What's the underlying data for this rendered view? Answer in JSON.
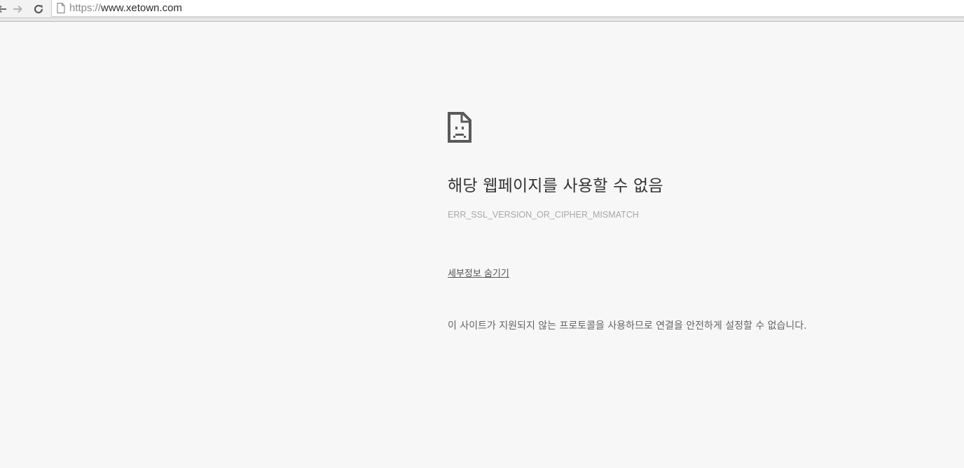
{
  "browser": {
    "url_scheme": "https://",
    "url_host": "www.xetown.com"
  },
  "error_page": {
    "icon": "sad-page-icon",
    "heading": "해당 웹페이지를 사용할 수 없음",
    "error_code": "ERR_SSL_VERSION_OR_CIPHER_MISMATCH",
    "details_link": "세부정보 숨기기",
    "explanation": "이 사이트가 지원되지 않는 프로토콜을 사용하므로 연결을 안전하게 설정할 수 없습니다."
  }
}
